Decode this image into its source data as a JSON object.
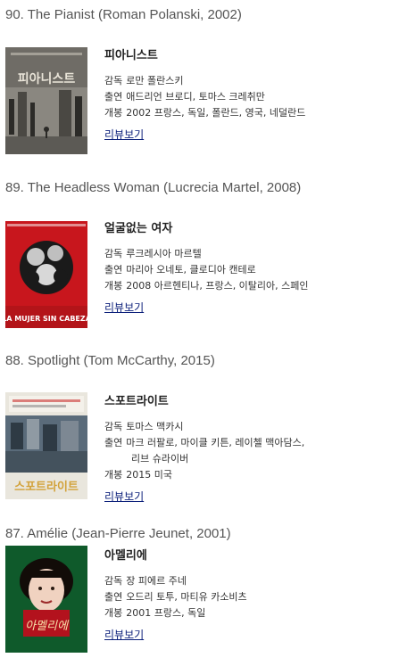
{
  "entries": [
    {
      "heading": "90. The Pianist (Roman Polanski, 2002)",
      "kr_title": "피아니스트",
      "director_key": "감독",
      "director": "로만 폴란스키",
      "cast_key": "출연",
      "cast": "애드리언 브로디, 토마스 크레취만",
      "cast_cont": "",
      "release_key": "개봉",
      "release": "2002 프랑스, 독일, 폴란드, 영국, 네덜란드",
      "review": "리뷰보기",
      "poster_text": "피아니스트",
      "poster_colors": [
        "#3b3a36",
        "#8a8780",
        "#d9d4c8"
      ]
    },
    {
      "heading": "89. The Headless Woman (Lucrecia Martel, 2008)",
      "kr_title": "얼굴없는 여자",
      "director_key": "감독",
      "director": "루크레시아 마르텔",
      "cast_key": "출연",
      "cast": "마리아 오네토, 클로디아 캔테로",
      "cast_cont": "",
      "release_key": "개봉",
      "release": "2008 아르헨티나, 프랑스, 이탈리아, 스페인",
      "review": "리뷰보기",
      "poster_text": "LA MUJER SIN CABEZA",
      "poster_colors": [
        "#c8161d",
        "#1a1a1a",
        "#e8e8e8"
      ]
    },
    {
      "heading": "88. Spotlight (Tom McCarthy, 2015)",
      "kr_title": "스포트라이트",
      "director_key": "감독",
      "director": "토마스 맥카시",
      "cast_key": "출연",
      "cast": "마크 러팔로, 마이클 키튼, 레이첼 맥아담스,",
      "cast_cont": "리브 슈라이버",
      "release_key": "개봉",
      "release": "2015 미국",
      "review": "리뷰보기",
      "poster_text": "스포트라이트",
      "poster_colors": [
        "#e9e6dd",
        "#5a6b7a",
        "#d2a23a"
      ]
    },
    {
      "heading": "87. Amélie (Jean-Pierre Jeunet, 2001)",
      "kr_title": "아멜리에",
      "director_key": "감독",
      "director": "장 피에르 주네",
      "cast_key": "출연",
      "cast": "오드리 토투, 마티유 카소비츠",
      "cast_cont": "",
      "release_key": "개봉",
      "release": "2001 프랑스, 독일",
      "review": "리뷰보기",
      "poster_text": "아멜리에",
      "poster_colors": [
        "#0f5a2b",
        "#b3121d",
        "#f0d2c0"
      ]
    }
  ]
}
